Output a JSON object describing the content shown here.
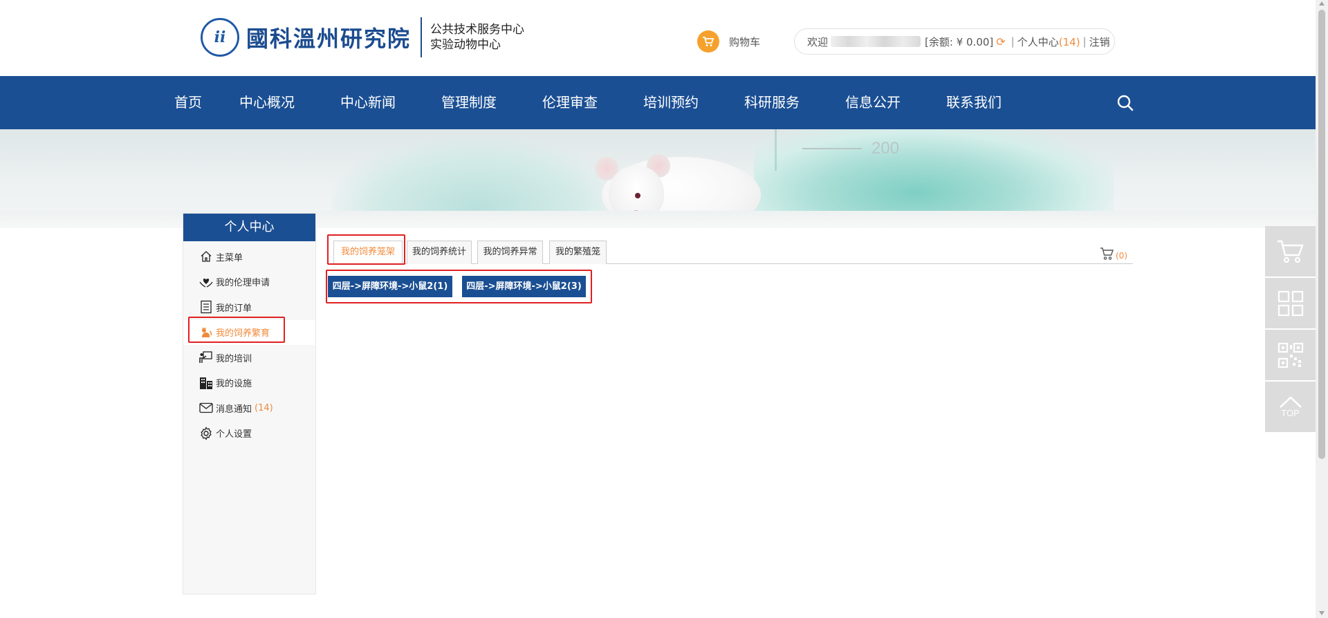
{
  "header": {
    "logo_seal_text": "ii",
    "logo_name": "國科溫州研究院",
    "logo_sub_line1": "公共技术服务中心",
    "logo_sub_line2": "实验动物中心",
    "cart_label": "购物车",
    "user": {
      "welcome": "欢迎",
      "balance_text": "[余额: ¥  0.00]",
      "refresh_icon": "refresh-icon",
      "personal_center_label": "个人中心",
      "personal_center_count": "(14)",
      "logout_label": "注销"
    }
  },
  "nav": {
    "items": [
      "首页",
      "中心概况",
      "中心新闻",
      "管理制度",
      "伦理审查",
      "培训预约",
      "科研服务",
      "信息公开",
      "联系我们"
    ],
    "search_icon": "search-icon"
  },
  "banner": {
    "flask_mark": "200"
  },
  "sidebar": {
    "title": "个人中心",
    "items": [
      {
        "label": "主菜单",
        "icon": "home-icon",
        "badge": ""
      },
      {
        "label": "我的伦理申请",
        "icon": "heart-hands-icon",
        "badge": ""
      },
      {
        "label": "我的订单",
        "icon": "order-list-icon",
        "badge": ""
      },
      {
        "label": "我的饲养繁育",
        "icon": "animal-icon",
        "badge": ""
      },
      {
        "label": "我的培训",
        "icon": "training-icon",
        "badge": ""
      },
      {
        "label": "我的设施",
        "icon": "building-icon",
        "badge": ""
      },
      {
        "label": "消息通知",
        "icon": "mail-icon",
        "badge": "(14)"
      },
      {
        "label": "个人设置",
        "icon": "settings-gear-icon",
        "badge": ""
      }
    ],
    "active_index": 3
  },
  "content": {
    "tabs": [
      "我的饲养笼架",
      "我的饲养统计",
      "我的饲养异常",
      "我的繁殖笼"
    ],
    "active_tab": 0,
    "cart_count": "(0)",
    "cage_buttons": [
      "四层->屏障环境->小鼠2(1)",
      "四层->屏障环境->小鼠2(3)"
    ]
  },
  "float_tools": {
    "items": [
      "cart-icon",
      "grid-icon",
      "qrcode-icon",
      "back-to-top-icon"
    ],
    "top_label": "TOP"
  },
  "colors": {
    "nav_blue": "#1b4f93",
    "accent_orange": "#f08a3b",
    "highlight_red": "#e02020"
  }
}
